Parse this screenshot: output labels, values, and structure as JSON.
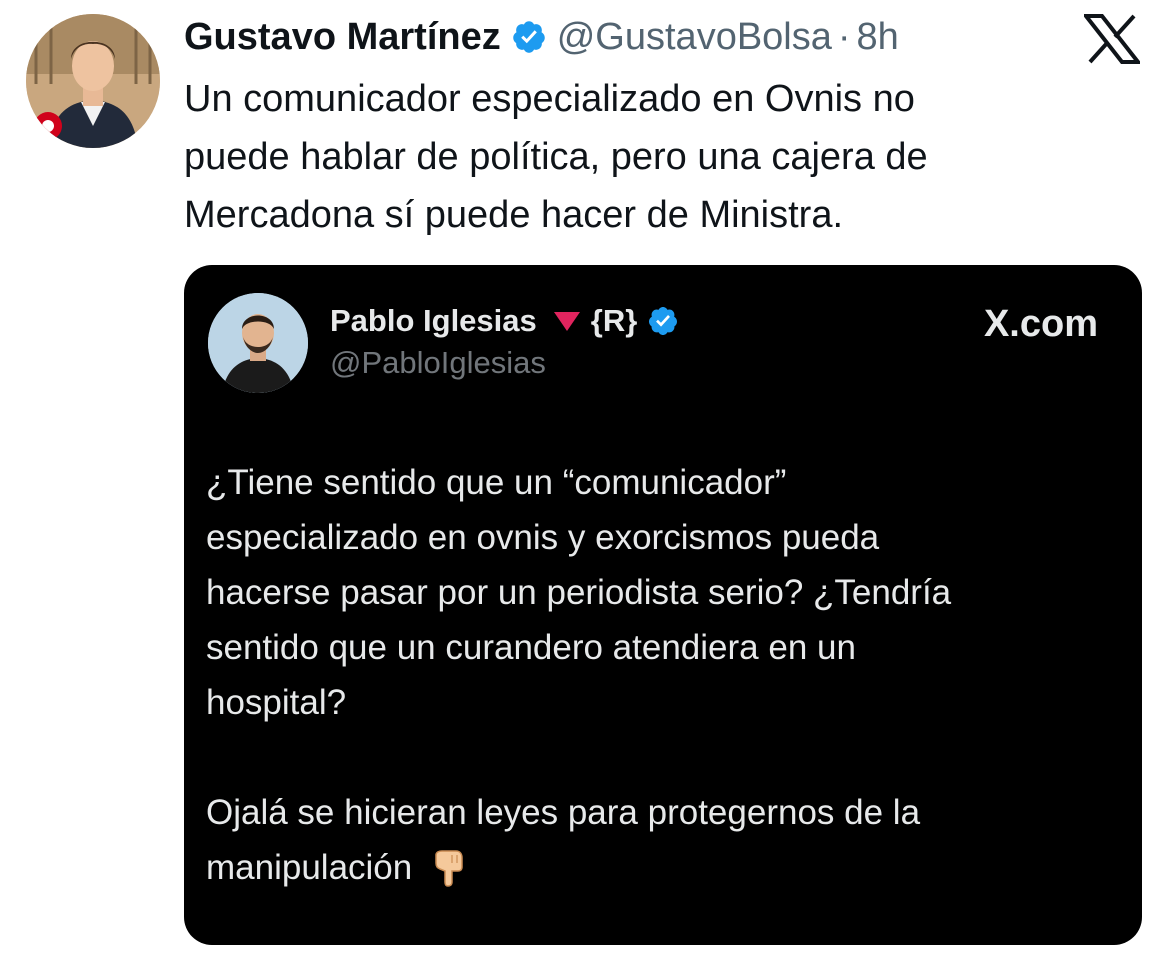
{
  "tweet": {
    "author": {
      "name": "Gustavo Martínez",
      "handle": "@GustavoBolsa",
      "time": "8h",
      "verified": true,
      "avatar_icon": "profile-photo"
    },
    "separator": "·",
    "text_lines": [
      "Un comunicador especializado en Ovnis no",
      "puede hablar de política, pero una cajera de",
      "Mercadona sí puede hacer de Ministra."
    ],
    "brand_icon": "x-logo"
  },
  "embedded": {
    "author": {
      "name": "Pablo Iglesias",
      "flag_icon": "red-triangle-down",
      "tag": "{R}",
      "handle": "@PabloIglesias",
      "verified": true
    },
    "domain": "X.com",
    "paragraph1": [
      "¿Tiene sentido que un “comunicador”",
      "especializado en ovnis y exorcismos pueda",
      "hacerse pasar por un periodista serio? ¿Tendría",
      "sentido que un curandero atendiera en un",
      "hospital?"
    ],
    "paragraph2": [
      "Ojalá se hicieran leyes para protegernos de la",
      "manipulación"
    ],
    "trailing_emoji_icon": "hand-pointing-down",
    "colors": {
      "background": "#000000",
      "text": "#e7e9ea",
      "muted": "#71767b",
      "verified": "#1d9bf0",
      "flag": "#e0245e"
    }
  }
}
